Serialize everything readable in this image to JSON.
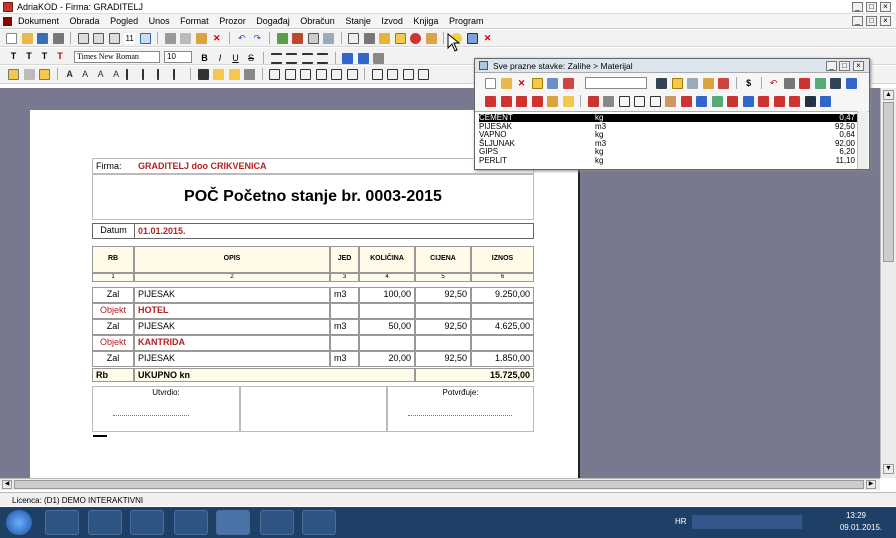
{
  "window": {
    "title": "AdriaKOD - Firma: GRADITELJ"
  },
  "menu": [
    "Dokument",
    "Obrada",
    "Pogled",
    "Unos",
    "Format",
    "Prozor",
    "Događaj",
    "Obračun",
    "Stanje",
    "Izvod",
    "Knjiga",
    "Program"
  ],
  "format": {
    "font": "Times New Roman",
    "size": "10"
  },
  "doc": {
    "firma_label": "Firma:",
    "firma": "GRADITELJ doo CRIKVENICA",
    "title": "POČ Početno stanje br. 0003-2015",
    "datum_label": "Datum",
    "datum": "01.01.2015.",
    "headers": [
      "RB",
      "OPIS",
      "JED",
      "KOLIČINA",
      "CIJENA",
      "IZNOS"
    ],
    "col_nums": [
      "1",
      "2",
      "3",
      "4",
      "5",
      "6"
    ],
    "rows": [
      {
        "rb": "Zal",
        "opis": "PIJESAK",
        "jed": "m3",
        "kol": "100,00",
        "cij": "92,50",
        "izn": "9.250,00"
      },
      {
        "rb": "Objekt",
        "opis": "HOTEL",
        "jed": "",
        "kol": "",
        "cij": "",
        "izn": ""
      },
      {
        "rb": "Zal",
        "opis": "PIJESAK",
        "jed": "m3",
        "kol": "50,00",
        "cij": "92,50",
        "izn": "4.625,00"
      },
      {
        "rb": "Objekt",
        "opis": "KANTRIDA",
        "jed": "",
        "kol": "",
        "cij": "",
        "izn": ""
      },
      {
        "rb": "Zal",
        "opis": "PIJESAK",
        "jed": "m3",
        "kol": "20,00",
        "cij": "92,50",
        "izn": "1.850,00"
      }
    ],
    "total_rb": "Rb",
    "total_label": "UKUPNO kn",
    "total": "15.725,00",
    "utvrdio": "Utvrdio:",
    "potvrdjuje": "Potvrđuje:"
  },
  "palette": {
    "title": "Sve prazne stavke: Zalihe > Materijal",
    "items": [
      {
        "name": "CEMENT",
        "unit": "kg",
        "price": "0,47"
      },
      {
        "name": "PIJESAK",
        "unit": "m3",
        "price": "92,50"
      },
      {
        "name": "VAPNO",
        "unit": "kg",
        "price": "0,64"
      },
      {
        "name": "ŠLJUNAK",
        "unit": "m3",
        "price": "92,00"
      },
      {
        "name": "GIPS",
        "unit": "kg",
        "price": "6,20"
      },
      {
        "name": "PERLIT",
        "unit": "kg",
        "price": "11,10"
      }
    ]
  },
  "status": {
    "licence": "Licenca:  (D1) DEMO INTERAKTIVNI"
  },
  "tray": {
    "lang": "HR",
    "time": "13:29",
    "date": "09.01.2015."
  }
}
